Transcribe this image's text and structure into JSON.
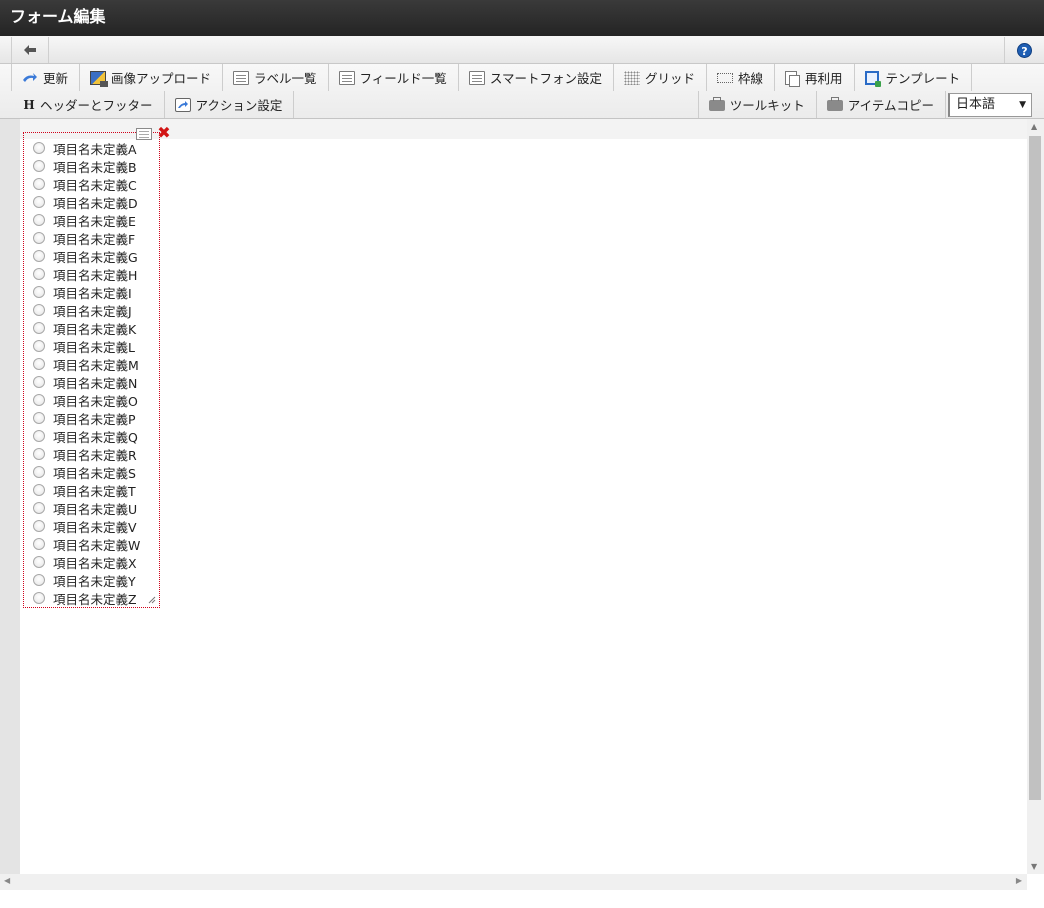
{
  "window": {
    "title": "フォーム編集"
  },
  "nav": {
    "back_icon": "arrow-left-icon",
    "help_icon": "help-icon",
    "help_glyph": "?"
  },
  "toolbar": {
    "row1": [
      {
        "id": "update",
        "label": "更新",
        "icon": "update-icon"
      },
      {
        "id": "image-upload",
        "label": "画像アップロード",
        "icon": "image-upload-icon"
      },
      {
        "id": "label-list",
        "label": "ラベル一覧",
        "icon": "list-icon"
      },
      {
        "id": "field-list",
        "label": "フィールド一覧",
        "icon": "list-icon"
      },
      {
        "id": "smartphone-settings",
        "label": "スマートフォン設定",
        "icon": "list-icon"
      },
      {
        "id": "grid",
        "label": "グリッド",
        "icon": "grid-icon"
      },
      {
        "id": "frame",
        "label": "枠線",
        "icon": "frame-icon"
      },
      {
        "id": "reuse",
        "label": "再利用",
        "icon": "copy-icon"
      },
      {
        "id": "template",
        "label": "テンプレート",
        "icon": "template-icon"
      }
    ],
    "row2_left": [
      {
        "id": "header-footer",
        "label": "ヘッダーとフッター",
        "icon": "header-icon"
      },
      {
        "id": "action-settings",
        "label": "アクション設定",
        "icon": "action-icon"
      }
    ],
    "row2_right": [
      {
        "id": "toolkit",
        "label": "ツールキット",
        "icon": "toolkit-icon"
      },
      {
        "id": "item-copy",
        "label": "アイテムコピー",
        "icon": "toolkit-icon"
      }
    ],
    "language": {
      "value": "日本語",
      "arrow": "▼"
    }
  },
  "radio_group": {
    "settings_icon": "settings-icon",
    "delete_icon": "delete-icon",
    "delete_glyph": "✖",
    "options": [
      "項目名未定義A",
      "項目名未定義B",
      "項目名未定義C",
      "項目名未定義D",
      "項目名未定義E",
      "項目名未定義F",
      "項目名未定義G",
      "項目名未定義H",
      "項目名未定義I",
      "項目名未定義J",
      "項目名未定義K",
      "項目名未定義L",
      "項目名未定義M",
      "項目名未定義N",
      "項目名未定義O",
      "項目名未定義P",
      "項目名未定義Q",
      "項目名未定義R",
      "項目名未定義S",
      "項目名未定義T",
      "項目名未定義U",
      "項目名未定義V",
      "項目名未定義W",
      "項目名未定義X",
      "項目名未定義Y",
      "項目名未定義Z"
    ]
  },
  "colors": {
    "title_bar": "#2b2b2b",
    "accent_red": "#d21414",
    "help_blue": "#1f5fb4"
  }
}
